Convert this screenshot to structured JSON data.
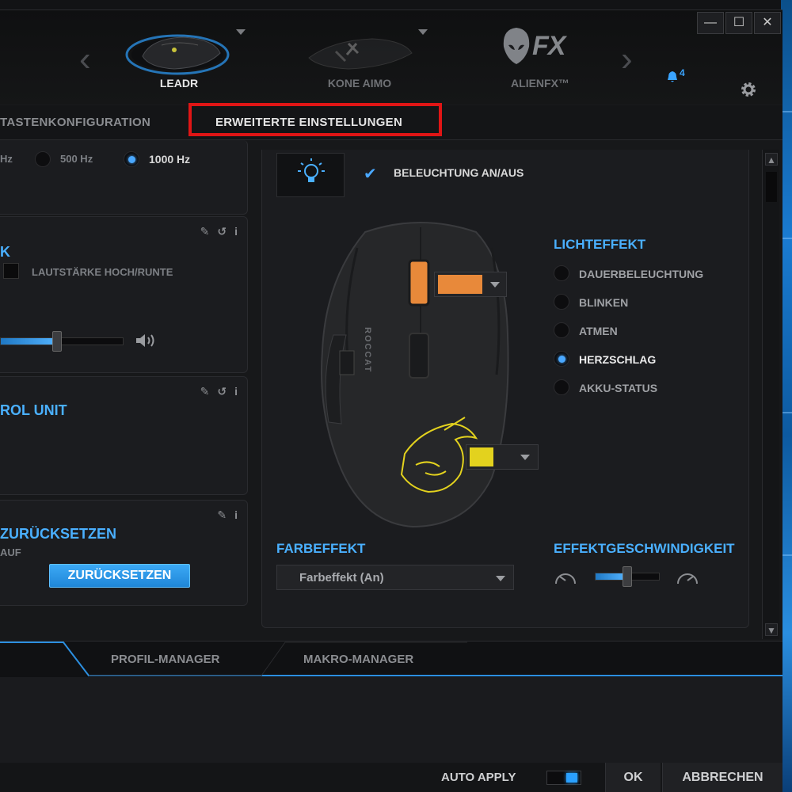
{
  "window": {
    "controls": {
      "minimize": "—",
      "maximize": "☐",
      "close": "✕"
    }
  },
  "devices": [
    {
      "label": "LEADR",
      "active": true
    },
    {
      "label": "KONE AIMO",
      "active": false
    },
    {
      "label": "ALIENFX™",
      "active": false
    }
  ],
  "header": {
    "nav_prev": "‹",
    "nav_next": "›",
    "alienfx_logo_text": "FX",
    "notifications_count": "4"
  },
  "tabs": {
    "button_config": "TASTENKONFIGURATION",
    "advanced_settings": "ERWEITERTE EINSTELLUNGEN"
  },
  "polling": {
    "partial_label": "Hz",
    "option_500": "500 Hz",
    "option_1000": "1000 Hz",
    "selected": "1000 Hz"
  },
  "panel_sound": {
    "title_partial": "K",
    "checkbox_label": "LAUTSTÄRKE HOCH/RUNTE",
    "volume_level": 0.46
  },
  "panel_control_unit": {
    "title_partial": "ROL UNIT"
  },
  "panel_reset": {
    "title_partial": "ZURÜCKSETZEN",
    "subtitle_partial": "AUF",
    "button_label": "ZURÜCKSETZEN"
  },
  "lighting": {
    "toggle_label": "BELEUCHTUNG AN/AUS",
    "toggle_checked": true,
    "effect_title": "LICHTEFFEKT",
    "effects": [
      "DAUERBELEUCHTUNG",
      "BLINKEN",
      "ATMEN",
      "HERZSCHLAG",
      "AKKU-STATUS"
    ],
    "selected_effect": "HERZSCHLAG",
    "zone_colors": {
      "wheel": "#e8893a",
      "logo": "#e3d21e"
    },
    "color_effect_title": "FARBEFFEKT",
    "color_effect_value": "Farbeffekt (An)",
    "speed_title": "EFFEKTGESCHWINDIGKEIT",
    "speed_level": 0.5
  },
  "mouse_brand": "ROCCAT",
  "bottom_tabs": [
    "PROFIL-MANAGER",
    "MAKRO-MANAGER"
  ],
  "footer": {
    "auto_apply_label": "AUTO APPLY",
    "auto_apply_on": true,
    "ok_label": "OK",
    "cancel_label": "ABBRECHEN"
  },
  "colors": {
    "accent": "#4ab0ff",
    "highlight_frame": "#e01515",
    "background": "#17181a"
  }
}
